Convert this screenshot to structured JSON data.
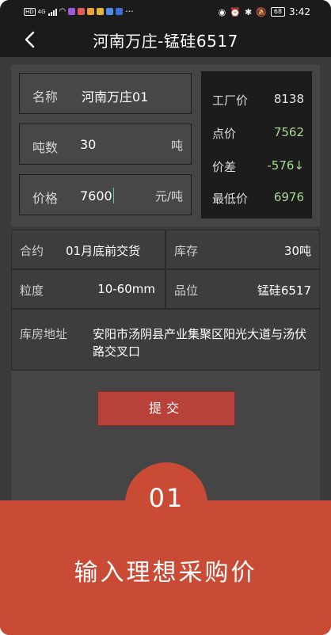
{
  "status_bar": {
    "left_labels": [
      "HD",
      "4G"
    ],
    "time": "3:42",
    "battery": "68",
    "more": "···"
  },
  "nav": {
    "title": "河南万庄-锰硅6517"
  },
  "form": {
    "name": {
      "label": "名称",
      "value": "河南万庄01"
    },
    "tonnage": {
      "label": "吨数",
      "value": "30",
      "unit": "吨"
    },
    "price": {
      "label": "价格",
      "value": "7600",
      "unit": "元/吨"
    }
  },
  "prices": [
    {
      "label": "工厂价",
      "value": "8138",
      "color": "#e8e8e8"
    },
    {
      "label": "点价",
      "value": "7562",
      "color": "#a9d98f"
    },
    {
      "label": "价差",
      "value": "-576↓",
      "color": "#a9d98f"
    },
    {
      "label": "最低价",
      "value": "6976",
      "color": "#a9d98f"
    }
  ],
  "info": {
    "contract": {
      "label": "合约",
      "value": "01月底前交货"
    },
    "stock": {
      "label": "库存",
      "value": "30吨"
    },
    "granularity": {
      "label": "粒度",
      "value": "10-60mm"
    },
    "grade": {
      "label": "品位",
      "value": "锰硅6517"
    },
    "address": {
      "label": "库房地址",
      "value": "安阳市汤阴县产业集聚区阳光大道与汤伏路交叉口"
    }
  },
  "submit_label": "提交",
  "banner": {
    "step": "01",
    "text": "输入理想采购价",
    "color": "#c94b36"
  }
}
